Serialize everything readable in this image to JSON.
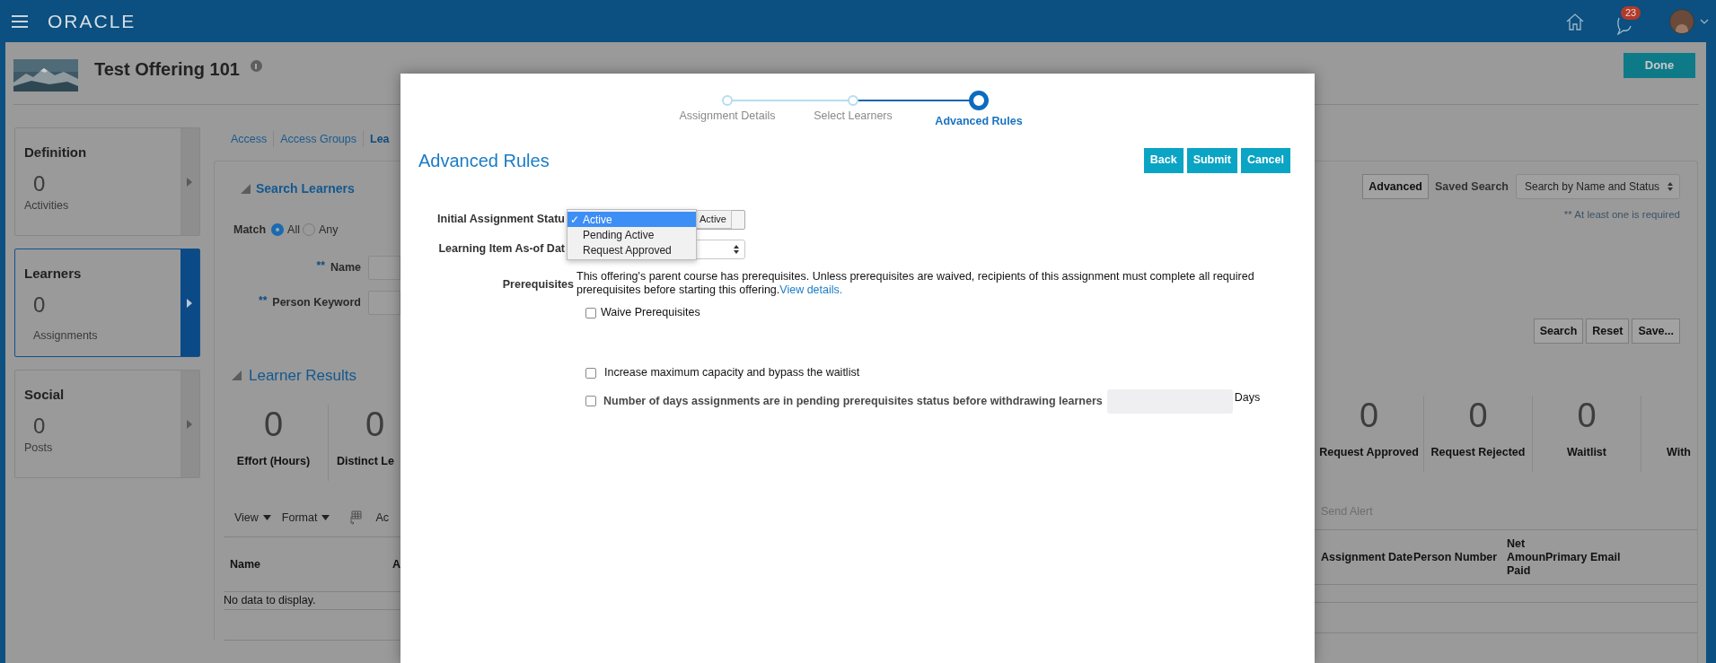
{
  "header": {
    "logo": "ORACLE",
    "notification_count": "23"
  },
  "page": {
    "title": "Test Offering 101",
    "done_button": "Done"
  },
  "side_cards": [
    {
      "title": "Definition",
      "count": "0",
      "label": "Activities",
      "selected": false
    },
    {
      "title": "Learners",
      "count": "0",
      "label": "Assignments",
      "selected": true
    },
    {
      "title": "Social",
      "count": "0",
      "label": "Posts",
      "selected": false
    }
  ],
  "tabs": [
    {
      "label": "Access",
      "selected": false
    },
    {
      "label": "Access Groups",
      "selected": false
    },
    {
      "label": "Lea",
      "selected": true
    }
  ],
  "search": {
    "title": "Search Learners",
    "match_label": "Match",
    "match_options": [
      {
        "label": "All",
        "selected": true
      },
      {
        "label": "Any",
        "selected": false
      }
    ],
    "fields": [
      {
        "marker": "**",
        "label": "Name"
      },
      {
        "marker": "**",
        "label": "Person Keyword"
      }
    ],
    "advanced_button": "Advanced",
    "saved_search_label": "Saved Search",
    "saved_search_value": "Search by Name and Status",
    "required_note": "** At least one is required",
    "buttons": [
      "Search",
      "Reset",
      "Save..."
    ]
  },
  "results": {
    "title": "Learner Results",
    "metrics_left": [
      {
        "value": "0",
        "label": "Effort (Hours)"
      },
      {
        "value": "0",
        "label": "Distinct Le"
      }
    ],
    "metrics_right": [
      {
        "value": "0",
        "label": "Request Approved"
      },
      {
        "value": "0",
        "label": "Request Rejected"
      },
      {
        "value": "0",
        "label": "Waitlist"
      },
      {
        "label": "With"
      }
    ]
  },
  "toolbar_left": [
    {
      "kind": "menu",
      "label": "View"
    },
    {
      "kind": "menu",
      "label": "Format"
    },
    {
      "kind": "icon"
    },
    {
      "kind": "text",
      "label": "Ac"
    }
  ],
  "toolbar_right": [
    {
      "label": "Send Alert",
      "disabled": true
    }
  ],
  "table": {
    "columns_left": [
      "Name",
      "A"
    ],
    "columns_right": [
      "Assignment Date",
      "Person Number",
      "Net Amoun Paid",
      "Primary Email"
    ],
    "empty_text": "No data to display."
  },
  "modal": {
    "steps": [
      {
        "label": "Assignment Details",
        "selected": false
      },
      {
        "label": "Select Learners",
        "selected": false
      },
      {
        "label": "Advanced Rules",
        "selected": true
      }
    ],
    "title": "Advanced Rules",
    "buttons": [
      "Back",
      "Submit",
      "Cancel"
    ],
    "fields": [
      {
        "label": "Initial Assignment Statu",
        "tooltip": "Active"
      },
      {
        "label": "Learning Item As-of Dat"
      }
    ],
    "dropdown": {
      "check_mark": "✓",
      "options": [
        {
          "label": "Active",
          "selected": true
        },
        {
          "label": "Pending Active",
          "selected": false
        },
        {
          "label": "Request Approved",
          "selected": false
        }
      ]
    },
    "prerequisites": {
      "label": "Prerequisites",
      "text": "This offering's parent course has prerequisites. Unless prerequisites are waived, recipients of this assignment must complete all required prerequisites before starting this offering.",
      "link": "View details."
    },
    "checkboxes": [
      {
        "label": "Waive Prerequisites",
        "checked": false,
        "kind": "plain"
      },
      {
        "label": "Increase maximum capacity and bypass the waitlist",
        "checked": false,
        "kind": "plain"
      },
      {
        "label": "Number of days assignments are in pending prerequisites status before withdrawing learners",
        "checked": false,
        "kind": "days",
        "unit": "Days"
      }
    ]
  }
}
